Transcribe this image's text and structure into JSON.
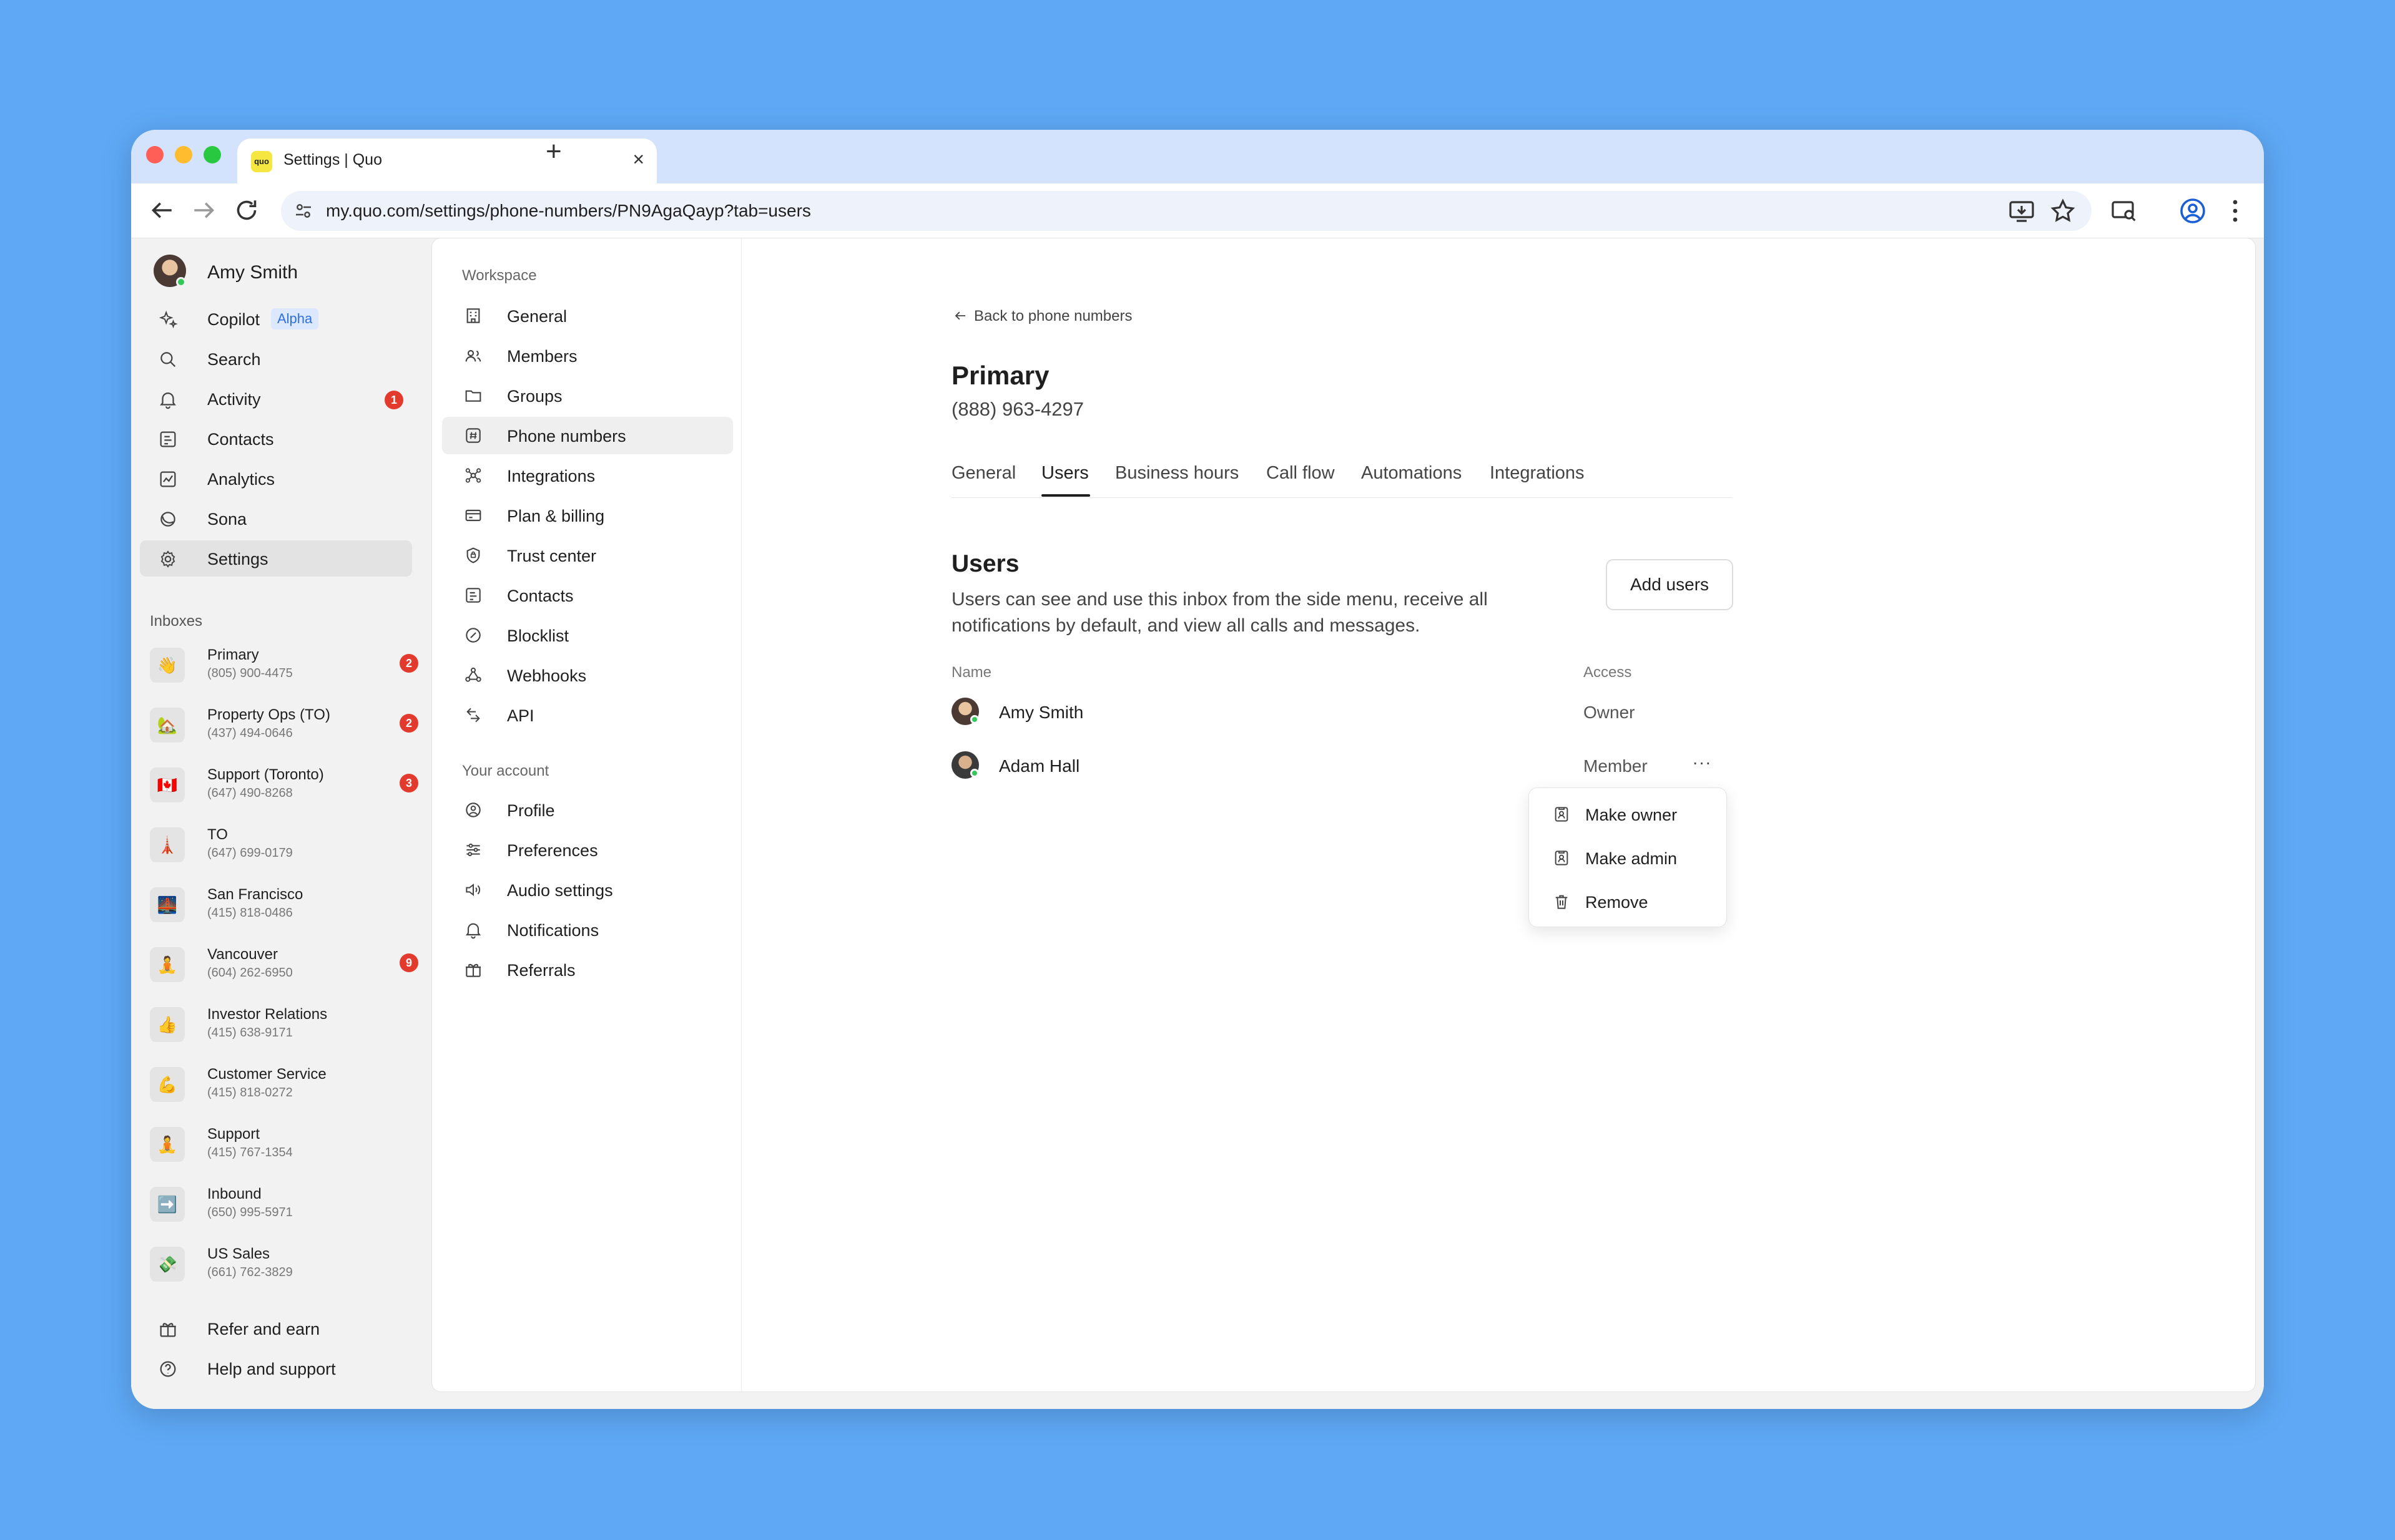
{
  "browser": {
    "tab_title": "Settings | Quo",
    "tab_favicon_text": "quo",
    "url": "my.quo.com/settings/phone-numbers/PN9AgaQayp?tab=users"
  },
  "sidebar": {
    "user_name": "Amy Smith",
    "nav": [
      {
        "label": "Copilot",
        "icon": "sparkle-icon",
        "badge": "Alpha"
      },
      {
        "label": "Search",
        "icon": "search-icon"
      },
      {
        "label": "Activity",
        "icon": "bell-icon",
        "count": "1"
      },
      {
        "label": "Contacts",
        "icon": "contacts-icon"
      },
      {
        "label": "Analytics",
        "icon": "analytics-icon"
      },
      {
        "label": "Sona",
        "icon": "sona-icon"
      },
      {
        "label": "Settings",
        "icon": "gear-icon",
        "active": true
      }
    ],
    "inboxes_heading": "Inboxes",
    "inboxes": [
      {
        "name": "Primary",
        "number": "(805) 900-4475",
        "emoji": "👋",
        "count": "2"
      },
      {
        "name": "Property Ops (TO)",
        "number": "(437) 494-0646",
        "emoji": "🏡",
        "count": "2"
      },
      {
        "name": "Support (Toronto)",
        "number": "(647) 490-8268",
        "emoji": "🇨🇦",
        "count": "3"
      },
      {
        "name": "TO",
        "number": "(647) 699-0179",
        "emoji": "🗼",
        "count": ""
      },
      {
        "name": "San Francisco",
        "number": "(415) 818-0486",
        "emoji": "🌉",
        "count": ""
      },
      {
        "name": "Vancouver",
        "number": "(604) 262-6950",
        "emoji": "🧘",
        "count": "9"
      },
      {
        "name": "Investor Relations",
        "number": "(415) 638-9171",
        "emoji": "👍",
        "count": ""
      },
      {
        "name": "Customer Service",
        "number": "(415) 818-0272",
        "emoji": "💪",
        "count": ""
      },
      {
        "name": "Support",
        "number": "(415) 767-1354",
        "emoji": "🧘",
        "count": ""
      },
      {
        "name": "Inbound",
        "number": "(650) 995-5971",
        "emoji": "➡️",
        "count": ""
      },
      {
        "name": "US Sales",
        "number": "(661) 762-3829",
        "emoji": "💸",
        "count": ""
      }
    ],
    "footer": [
      {
        "label": "Refer and earn",
        "icon": "gift-icon"
      },
      {
        "label": "Help and support",
        "icon": "help-icon"
      }
    ]
  },
  "settings_nav": {
    "workspace_heading": "Workspace",
    "workspace": [
      {
        "label": "General",
        "icon": "building-icon"
      },
      {
        "label": "Members",
        "icon": "members-icon"
      },
      {
        "label": "Groups",
        "icon": "folder-icon"
      },
      {
        "label": "Phone numbers",
        "icon": "hash-icon",
        "active": true
      },
      {
        "label": "Integrations",
        "icon": "integrations-icon"
      },
      {
        "label": "Plan & billing",
        "icon": "card-icon"
      },
      {
        "label": "Trust center",
        "icon": "shield-icon"
      },
      {
        "label": "Contacts",
        "icon": "contacts-icon"
      },
      {
        "label": "Blocklist",
        "icon": "block-icon"
      },
      {
        "label": "Webhooks",
        "icon": "webhook-icon"
      },
      {
        "label": "API",
        "icon": "api-icon"
      }
    ],
    "account_heading": "Your account",
    "account": [
      {
        "label": "Profile",
        "icon": "profile-icon"
      },
      {
        "label": "Preferences",
        "icon": "sliders-icon"
      },
      {
        "label": "Audio settings",
        "icon": "speaker-icon"
      },
      {
        "label": "Notifications",
        "icon": "bell-icon"
      },
      {
        "label": "Referrals",
        "icon": "gift-icon"
      }
    ]
  },
  "detail": {
    "back_label": "Back to phone numbers",
    "title": "Primary",
    "number": "(888) 963-4297",
    "tabs": [
      "General",
      "Users",
      "Business hours",
      "Call flow",
      "Automations",
      "Integrations"
    ],
    "active_tab": "Users",
    "users_heading": "Users",
    "users_description": "Users can see and use this inbox from the side menu, receive all notifications by default, and view all calls and messages.",
    "add_users_label": "Add users",
    "col_name": "Name",
    "col_access": "Access",
    "users": [
      {
        "name": "Amy Smith",
        "access": "Owner"
      },
      {
        "name": "Adam Hall",
        "access": "Member"
      }
    ],
    "more_label": "···",
    "menu": [
      {
        "label": "Make owner",
        "icon": "owner-icon"
      },
      {
        "label": "Make admin",
        "icon": "admin-icon"
      },
      {
        "label": "Remove",
        "icon": "trash-icon"
      }
    ]
  }
}
